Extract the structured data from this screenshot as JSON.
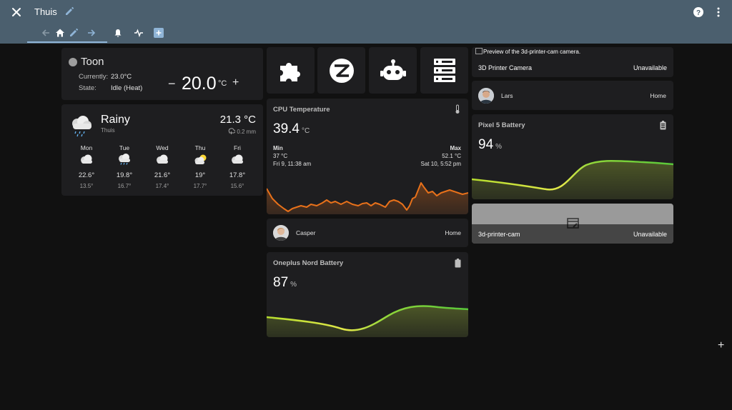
{
  "header": {
    "title": "Thuis",
    "tabs": [
      "back-arrow-icon",
      "home-icon",
      "pencil-icon",
      "arrow-right-icon",
      "bell-icon",
      "pulse-icon",
      "add-tab-icon"
    ],
    "accent": "#8fb4d6",
    "bar_color": "#4b5f6e"
  },
  "thermostat": {
    "name": "Toon",
    "currently_label": "Currently:",
    "currently_value": "23.0°C",
    "state_label": "State:",
    "state_value": "Idle (Heat)",
    "minus": "−",
    "target": "20.0",
    "unit": "°C",
    "plus": "+"
  },
  "weather": {
    "state": "Rainy",
    "location": "Thuis",
    "temperature": "21.3 °C",
    "precipitation": "0.2 mm",
    "forecast": [
      {
        "day": "Mon",
        "icon": "cloudy-icon",
        "high": "22.6°",
        "low": "13.5°"
      },
      {
        "day": "Tue",
        "icon": "rainy-icon",
        "high": "19.8°",
        "low": "16.7°"
      },
      {
        "day": "Wed",
        "icon": "cloudy-icon",
        "high": "21.6°",
        "low": "17.4°"
      },
      {
        "day": "Thu",
        "icon": "partly-cloudy-icon",
        "high": "19°",
        "low": "17.7°"
      },
      {
        "day": "Fri",
        "icon": "cloudy-icon",
        "high": "17.8°",
        "low": "15.6°"
      }
    ]
  },
  "buttons": [
    "puzzle-icon",
    "zigbee-icon",
    "robot-icon",
    "server-icon"
  ],
  "cpu": {
    "name": "CPU Temperature",
    "value": "39.4",
    "unit": "°C",
    "min_label": "Min",
    "min_value": "37 °C",
    "min_time": "Fri 9, 11:38 am",
    "max_label": "Max",
    "max_value": "52.1 °C",
    "max_time": "Sat 10, 5:52 pm",
    "line_color": "#e8711a"
  },
  "casper": {
    "name": "Casper",
    "state": "Home"
  },
  "oneplus": {
    "name": "Oneplus Nord Battery",
    "value": "87",
    "unit": "%"
  },
  "camera_top": {
    "preview": "Preview of the 3d-printer-cam camera.",
    "title": "3D Printer Camera",
    "state": "Unavailable"
  },
  "lars": {
    "name": "Lars",
    "state": "Home"
  },
  "pixel": {
    "name": "Pixel 5 Battery",
    "value": "94",
    "unit": "%"
  },
  "camera_bottom": {
    "title": "3d-printer-cam",
    "state": "Unavailable"
  },
  "fab": "+"
}
